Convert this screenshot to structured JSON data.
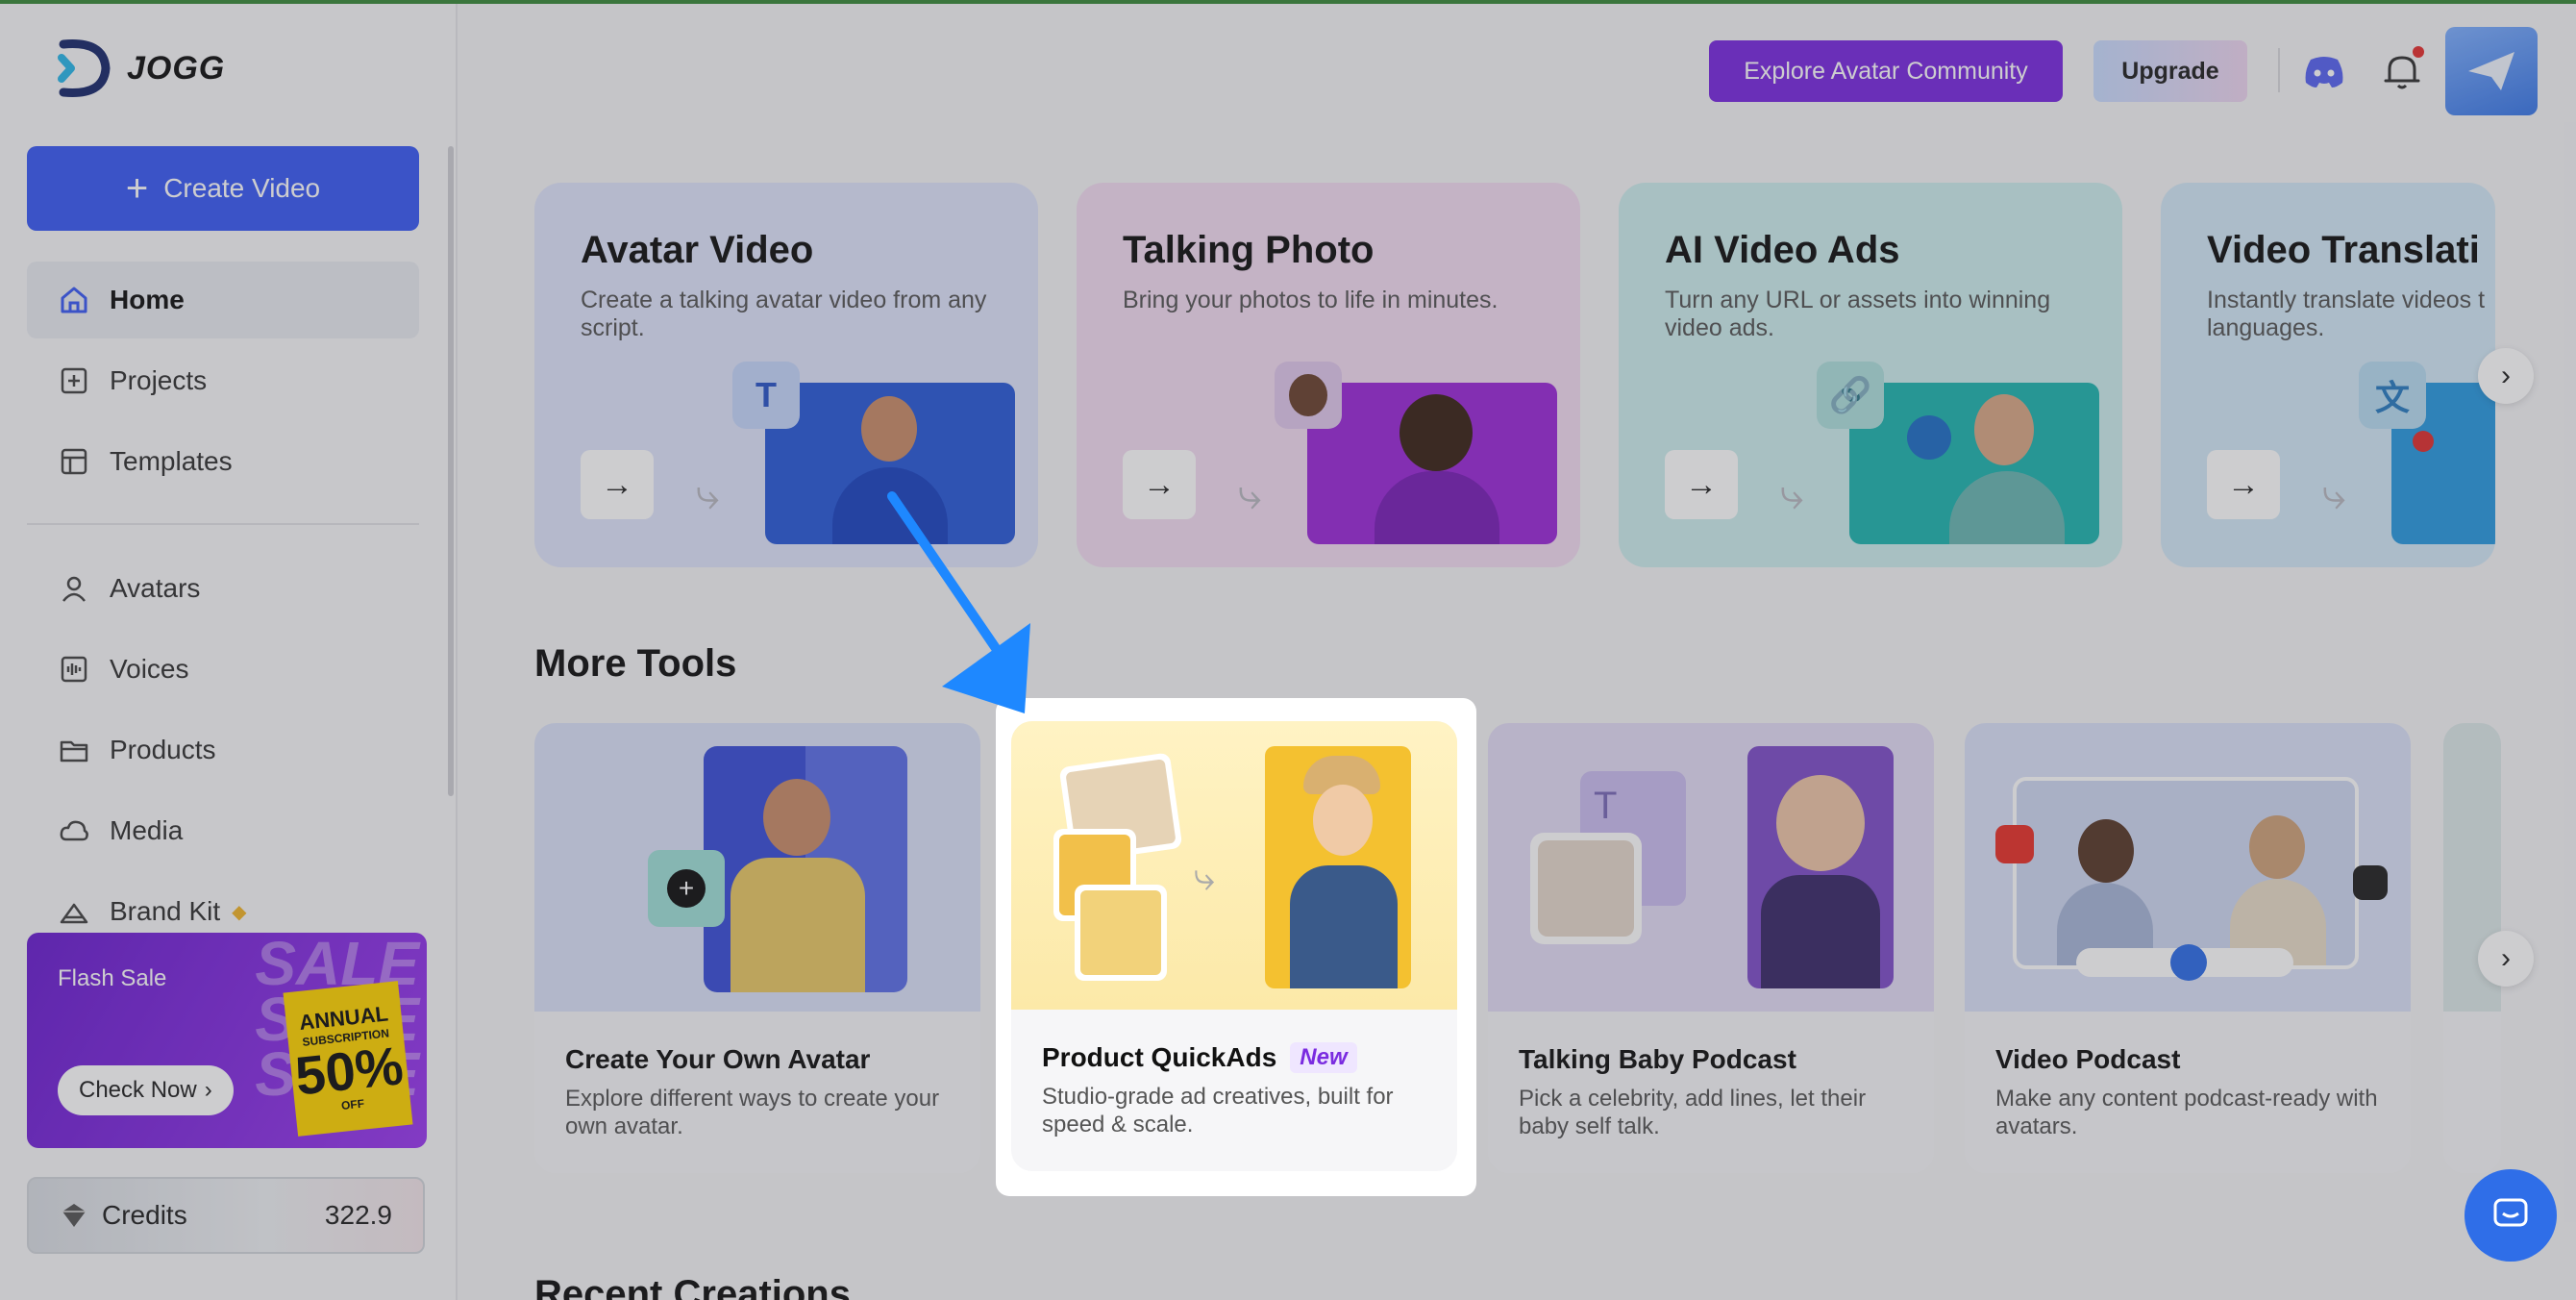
{
  "app": {
    "name": "JOGG"
  },
  "sidebar": {
    "create_label": "Create Video",
    "items": [
      {
        "label": "Home",
        "icon": "home-icon"
      },
      {
        "label": "Projects",
        "icon": "projects-icon"
      },
      {
        "label": "Templates",
        "icon": "templates-icon"
      },
      {
        "label": "Avatars",
        "icon": "avatar-person-icon"
      },
      {
        "label": "Voices",
        "icon": "voice-wave-icon"
      },
      {
        "label": "Products",
        "icon": "folder-icon"
      },
      {
        "label": "Media",
        "icon": "cloud-icon"
      },
      {
        "label": "Brand Kit",
        "icon": "brand-kit-icon"
      }
    ],
    "promo": {
      "title": "Flash Sale",
      "button": "Check Now",
      "sale_word": "SALE",
      "badge_line1": "ANNUAL",
      "badge_line2": "SUBSCRIPTION",
      "badge_line3": "50%",
      "badge_line4": "OFF"
    },
    "credits": {
      "label": "Credits",
      "value": "322.9"
    }
  },
  "header": {
    "explore_label": "Explore Avatar Community",
    "upgrade_label": "Upgrade"
  },
  "features": [
    {
      "title": "Avatar Video",
      "desc": "Create a talking avatar video from any script.",
      "chip": "T"
    },
    {
      "title": "Talking Photo",
      "desc": "Bring your photos to life in minutes."
    },
    {
      "title": "AI Video Ads",
      "desc": "Turn any URL or assets into winning video ads."
    },
    {
      "title": "Video Translati",
      "desc": "Instantly translate videos t languages."
    }
  ],
  "more_tools": {
    "title": "More Tools",
    "items": [
      {
        "title": "Create Your Own Avatar",
        "desc": "Explore different ways to create your own avatar."
      },
      {
        "title": "Product QuickAds",
        "badge": "New",
        "desc": "Studio-grade ad creatives, built for speed & scale."
      },
      {
        "title": "Talking Baby Podcast",
        "desc": "Pick a celebrity, add lines, let their baby self talk."
      },
      {
        "title": "Video Podcast",
        "desc": "Make any content podcast-ready with avatars."
      }
    ]
  },
  "recent": {
    "title": "Recent Creations"
  },
  "colors": {
    "accent": "#3b5bf5",
    "explore": "#7a2be0",
    "arrow": "#1e88ff"
  }
}
